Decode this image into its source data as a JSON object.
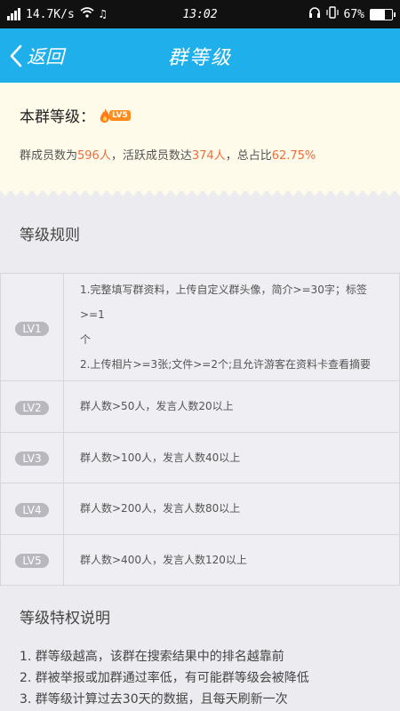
{
  "status_bar": {
    "speed": "14.7K/s",
    "time": "13:02",
    "battery": "67%",
    "battery_fraction": 0.67
  },
  "header": {
    "back_label": "返回",
    "title": "群等级"
  },
  "level_card": {
    "label": "本群等级：",
    "badge": "LV5",
    "members_prefix": "群成员数为",
    "members_count": "596人",
    "active_prefix": "，活跃成员数达",
    "active_count": "374人",
    "ratio_prefix": "，总占比",
    "ratio": "62.75%"
  },
  "rules": {
    "title": "等级规则",
    "rows": [
      {
        "level": "LV1",
        "lines": [
          "1.完整填写群资料，上传自定义群头像，简介>=30字；标签>=1",
          "个",
          "2.上传相片>=3张;文件>=2个;且允许游客在资料卡查看摘要"
        ]
      },
      {
        "level": "LV2",
        "lines": [
          "群人数>50人，发言人数20以上"
        ]
      },
      {
        "level": "LV3",
        "lines": [
          "群人数>100人，发言人数40以上"
        ]
      },
      {
        "level": "LV4",
        "lines": [
          "群人数>200人，发言人数80以上"
        ]
      },
      {
        "level": "LV5",
        "lines": [
          "群人数>400人，发言人数120以上"
        ]
      }
    ]
  },
  "privileges": {
    "title": "等级特权说明",
    "items": [
      "1. 群等级越高，该群在搜索结果中的排名越靠前",
      "2. 群被举报或加群通过率低，有可能群等级会被降低",
      "3. 群等级计算过去30天的数据，且每天刷新一次"
    ]
  },
  "colors": {
    "accent": "#1fb0ec",
    "highlight": "#f36c3c",
    "badge": "#ff8c1a"
  }
}
